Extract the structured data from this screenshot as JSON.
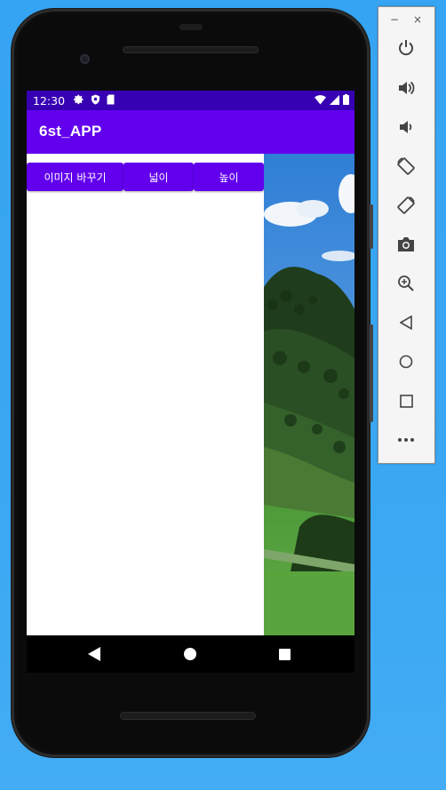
{
  "status_bar": {
    "time": "12:30",
    "left_icons": [
      "gear-icon",
      "shield-icon",
      "sd-card-icon"
    ],
    "right_icons": [
      "wifi-icon",
      "signal-icon",
      "battery-icon"
    ]
  },
  "app_bar": {
    "title": "6st_APP"
  },
  "buttons": {
    "change_image": "이미지 바꾸기",
    "width": "넓이",
    "height": "높이"
  },
  "navigation": [
    "back-icon",
    "home-icon",
    "recents-icon"
  ],
  "emulator_toolbar": {
    "window_controls": {
      "minimize": "−",
      "close": "×"
    },
    "tools": [
      "power-icon",
      "volume-up-icon",
      "volume-down-icon",
      "rotate-left-icon",
      "rotate-right-icon",
      "camera-icon",
      "zoom-icon",
      "back-icon",
      "home-icon",
      "overview-icon",
      "more-icon"
    ]
  },
  "colors": {
    "status_bar": "#3700b3",
    "primary": "#6200ee",
    "desktop": "#3aa7f3"
  }
}
